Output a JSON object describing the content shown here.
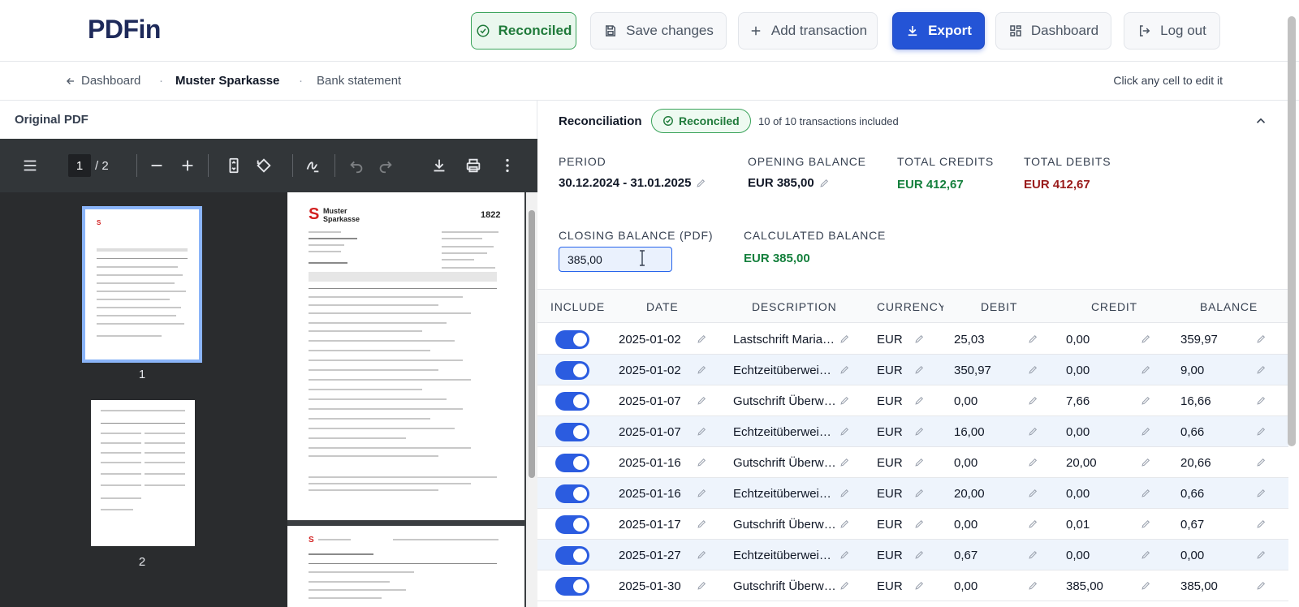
{
  "header": {
    "logo": "PDFin",
    "reconciled_label": "Reconciled",
    "save_label": "Save changes",
    "add_label": "Add transaction",
    "export_label": "Export",
    "dashboard_label": "Dashboard",
    "logout_label": "Log out"
  },
  "breadcrumb": {
    "back_label": "Dashboard",
    "sep": "·",
    "bank": "Muster Sparkasse",
    "document": "Bank statement",
    "hint": "Click any cell to edit it"
  },
  "pdf": {
    "title": "Original PDF",
    "current_page": "1",
    "total_pages": "/ 2",
    "thumb_labels": [
      "1",
      "2"
    ],
    "page_heading_1": "Muster",
    "page_heading_2": "Sparkasse",
    "page_code": "1822"
  },
  "reconciliation": {
    "title": "Reconciliation",
    "badge": "Reconciled",
    "count": "10 of 10 transactions included",
    "period_label": "PERIOD",
    "period_value": "30.12.2024 - 31.01.2025",
    "opening_label": "OPENING BALANCE",
    "opening_value": "EUR 385,00",
    "credits_label": "TOTAL CREDITS",
    "credits_value": "EUR 412,67",
    "debits_label": "TOTAL DEBITS",
    "debits_value": "EUR 412,67",
    "closing_label": "CLOSING BALANCE (PDF)",
    "closing_value": "385,00",
    "calculated_label": "CALCULATED BALANCE",
    "calculated_value": "EUR 385,00"
  },
  "table": {
    "headers": [
      "INCLUDE",
      "DATE",
      "DESCRIPTION",
      "CURRENCY",
      "DEBIT",
      "CREDIT",
      "BALANCE"
    ],
    "rows": [
      {
        "date": "2025-01-02",
        "description": "Lastschrift Maria…",
        "currency": "EUR",
        "debit": "25,03",
        "credit": "0,00",
        "balance": "359,97"
      },
      {
        "date": "2025-01-02",
        "description": "Echtzeitüberwei…",
        "currency": "EUR",
        "debit": "350,97",
        "credit": "0,00",
        "balance": "9,00"
      },
      {
        "date": "2025-01-07",
        "description": "Gutschrift Überw…",
        "currency": "EUR",
        "debit": "0,00",
        "credit": "7,66",
        "balance": "16,66"
      },
      {
        "date": "2025-01-07",
        "description": "Echtzeitüberwei…",
        "currency": "EUR",
        "debit": "16,00",
        "credit": "0,00",
        "balance": "0,66"
      },
      {
        "date": "2025-01-16",
        "description": "Gutschrift Überw…",
        "currency": "EUR",
        "debit": "0,00",
        "credit": "20,00",
        "balance": "20,66"
      },
      {
        "date": "2025-01-16",
        "description": "Echtzeitüberwei…",
        "currency": "EUR",
        "debit": "20,00",
        "credit": "0,00",
        "balance": "0,66"
      },
      {
        "date": "2025-01-17",
        "description": "Gutschrift Überw…",
        "currency": "EUR",
        "debit": "0,00",
        "credit": "0,01",
        "balance": "0,67"
      },
      {
        "date": "2025-01-27",
        "description": "Echtzeitüberwei…",
        "currency": "EUR",
        "debit": "0,67",
        "credit": "0,00",
        "balance": "0,00"
      },
      {
        "date": "2025-01-30",
        "description": "Gutschrift Überw…",
        "currency": "EUR",
        "debit": "0,00",
        "credit": "385,00",
        "balance": "385,00"
      }
    ]
  },
  "colors": {
    "accent": "#2454d6",
    "success": "#15803d",
    "danger": "#991b1b",
    "pdf_toolbar": "#323639"
  }
}
